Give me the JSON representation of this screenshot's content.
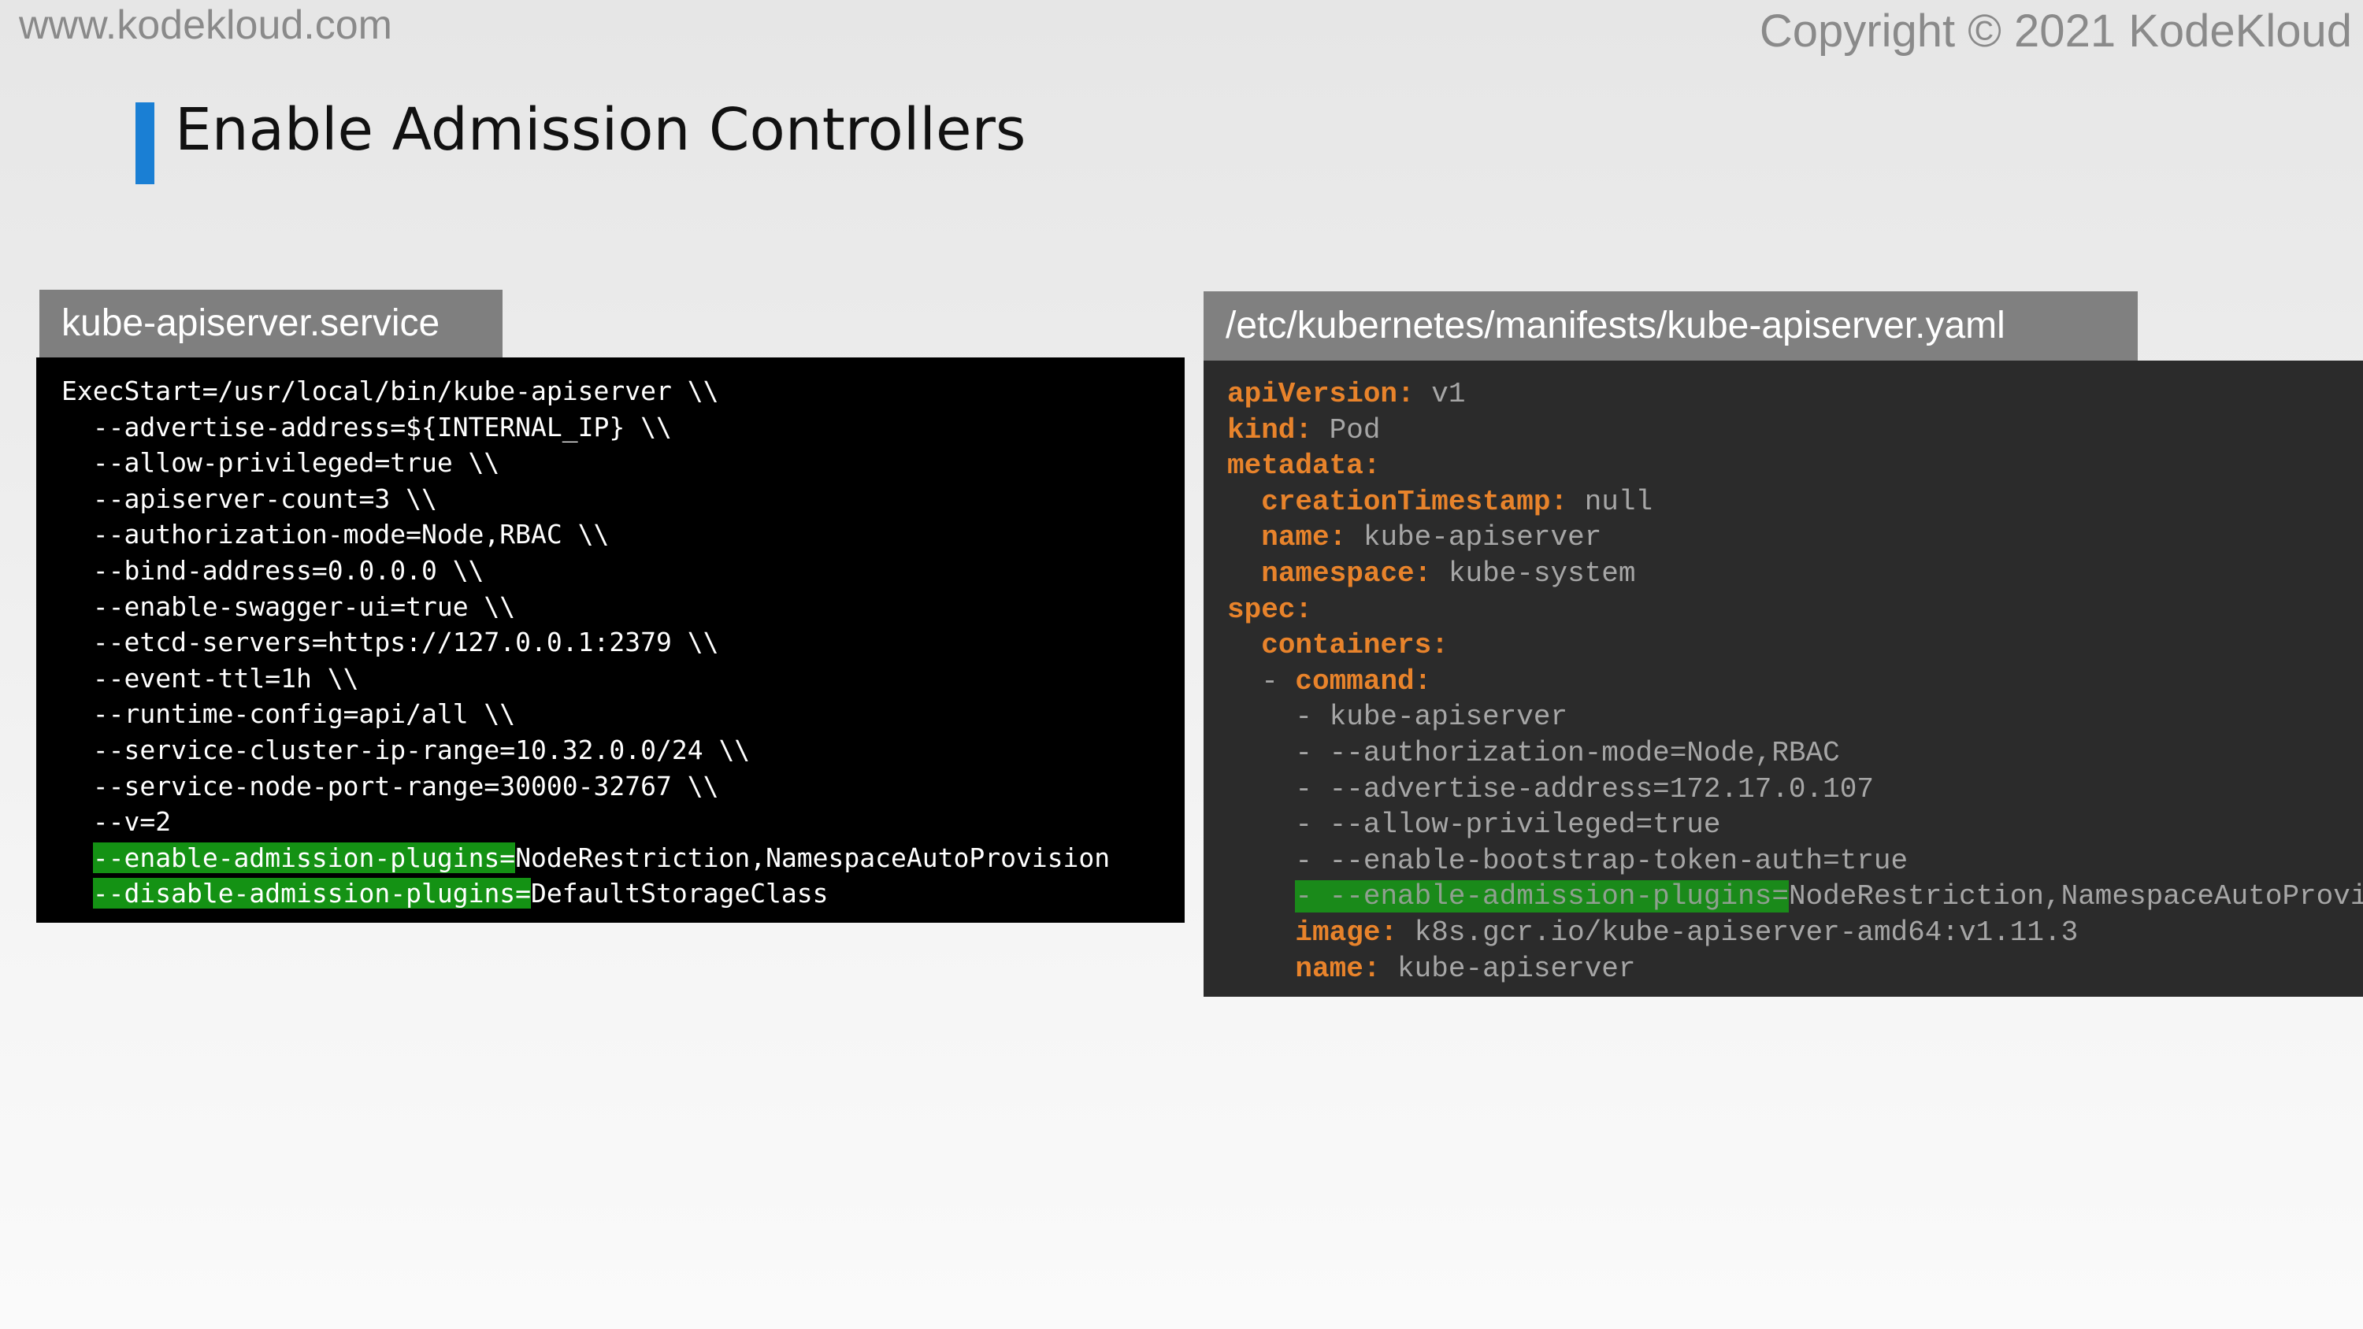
{
  "header": {
    "site_url": "www.kodekloud.com",
    "copyright": "Copyright © 2021 KodeKloud",
    "title": "Enable Admission Controllers",
    "accent_color": "#1a7fd4"
  },
  "left_panel": {
    "tab_label": "kube-apiserver.service",
    "lines": [
      "ExecStart=/usr/local/bin/kube-apiserver \\\\",
      "  --advertise-address=${INTERNAL_IP} \\\\",
      "  --allow-privileged=true \\\\",
      "  --apiserver-count=3 \\\\",
      "  --authorization-mode=Node,RBAC \\\\",
      "  --bind-address=0.0.0.0 \\\\",
      "  --enable-swagger-ui=true \\\\",
      "  --etcd-servers=https://127.0.0.1:2379 \\\\",
      "  --event-ttl=1h \\\\",
      "  --runtime-config=api/all \\\\",
      "  --service-cluster-ip-range=10.32.0.0/24 \\\\",
      "  --service-node-port-range=30000-32767 \\\\",
      "  --v=2"
    ],
    "highlight_lines": [
      {
        "indent": "  ",
        "flag": "--enable-admission-plugins=",
        "value": "NodeRestriction,NamespaceAutoProvision"
      },
      {
        "indent": "  ",
        "flag": "--disable-admission-plugins=",
        "value": "DefaultStorageClass"
      }
    ],
    "highlight_color": "#149214"
  },
  "right_panel": {
    "tab_label": "/etc/kubernetes/manifests/kube-apiserver.yaml",
    "lines": [
      {
        "indent": "",
        "key": "apiVersion:",
        "value": " v1"
      },
      {
        "indent": "",
        "key": "kind:",
        "value": " Pod"
      },
      {
        "indent": "",
        "key": "metadata:",
        "value": ""
      },
      {
        "indent": "  ",
        "key": "creationTimestamp:",
        "value": " null"
      },
      {
        "indent": "  ",
        "key": "name:",
        "value": " kube-apiserver"
      },
      {
        "indent": "  ",
        "key": "namespace:",
        "value": " kube-system"
      },
      {
        "indent": "",
        "key": "spec:",
        "value": ""
      },
      {
        "indent": "  ",
        "key": "containers:",
        "value": ""
      },
      {
        "indent": "  - ",
        "key": "command:",
        "value": ""
      },
      {
        "indent": "",
        "key": "",
        "value": "    - kube-apiserver"
      },
      {
        "indent": "",
        "key": "",
        "value": "    - --authorization-mode=Node,RBAC"
      },
      {
        "indent": "",
        "key": "",
        "value": "    - --advertise-address=172.17.0.107"
      },
      {
        "indent": "",
        "key": "",
        "value": "    - --allow-privileged=true"
      },
      {
        "indent": "",
        "key": "",
        "value": "    - --enable-bootstrap-token-auth=true"
      }
    ],
    "highlight_line": {
      "indent": "    ",
      "flag": "- --enable-admission-plugins=",
      "value": "NodeRestriction,NamespaceAutoProvision"
    },
    "tail_lines": [
      {
        "indent": "    ",
        "key": "image:",
        "value": " k8s.gcr.io/kube-apiserver-amd64:v1.11.3"
      },
      {
        "indent": "    ",
        "key": "name:",
        "value": " kube-apiserver"
      }
    ],
    "key_color": "#e8832b",
    "value_color": "#a6a6a6"
  }
}
